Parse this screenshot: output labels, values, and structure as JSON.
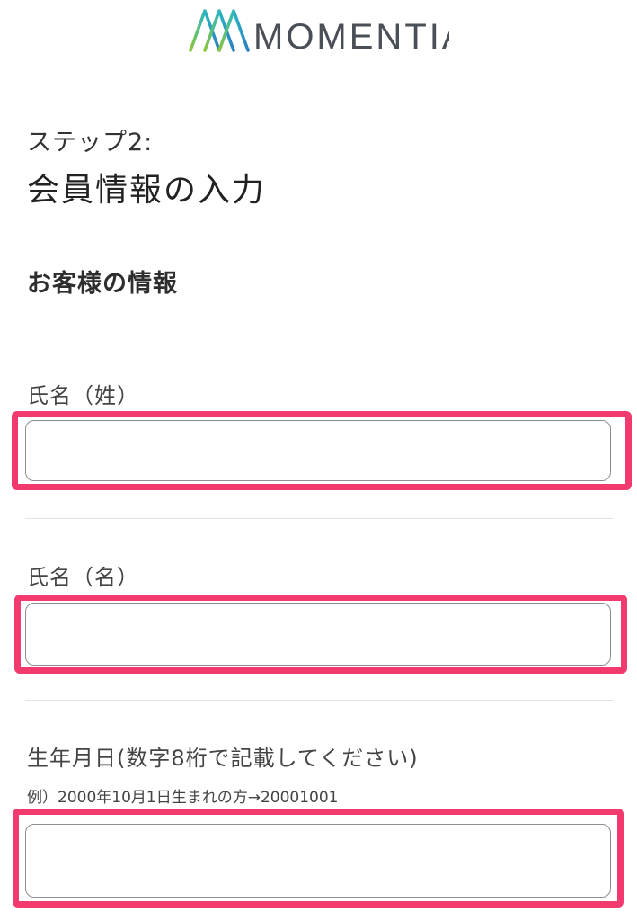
{
  "brand": {
    "name": "MOMENTIA",
    "colors": {
      "gradient_start": "#8cc63f",
      "gradient_mid": "#2bb5c0",
      "gradient_end": "#2a7fc1",
      "text": "#4a4f57"
    }
  },
  "step": {
    "label": "ステップ2:",
    "title": "会員情報の入力"
  },
  "section": {
    "heading": "お客様の情報"
  },
  "fields": {
    "last_name": {
      "label": "氏名（姓）",
      "value": "",
      "placeholder": ""
    },
    "first_name": {
      "label": "氏名（名）",
      "value": "",
      "placeholder": ""
    },
    "birthdate": {
      "label": "生年月日(数字8桁で記載してください)",
      "hint": "例）2000年10月1日生まれの方→20001001",
      "value": "",
      "placeholder": ""
    }
  },
  "highlight_color": "#f23a6e"
}
